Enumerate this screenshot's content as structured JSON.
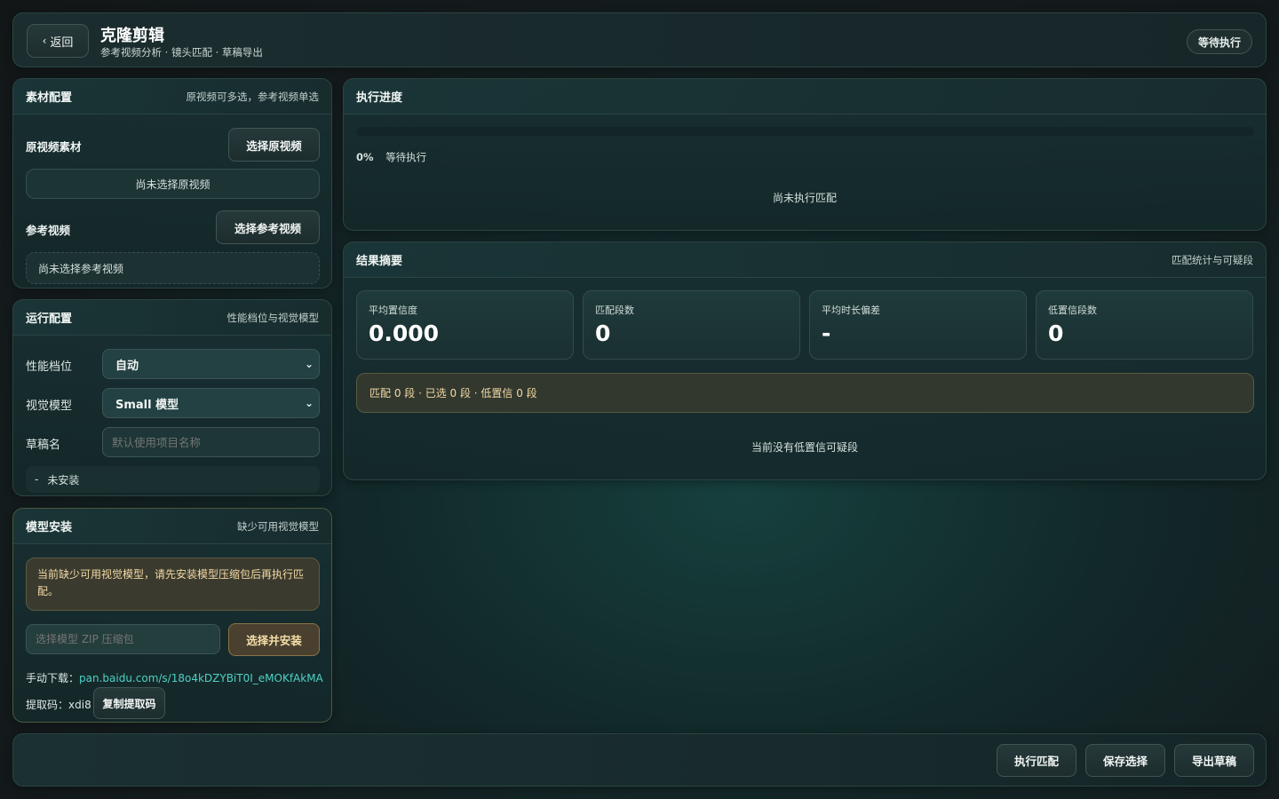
{
  "header": {
    "back_label": "返回",
    "title": "克隆剪辑",
    "subtitle": "参考视频分析 · 镜头匹配 · 草稿导出",
    "status_badge": "等待执行"
  },
  "materials": {
    "title": "素材配置",
    "subtitle": "原视频可多选，参考视频单选",
    "source_label": "原视频素材",
    "source_button": "选择原视频",
    "source_empty": "尚未选择原视频",
    "ref_label": "参考视频",
    "ref_button": "选择参考视频",
    "ref_empty": "尚未选择参考视频"
  },
  "run_config": {
    "title": "运行配置",
    "subtitle": "性能档位与视觉模型",
    "perf_label": "性能档位",
    "perf_value": "自动",
    "model_label": "视觉模型",
    "model_value": "Small 模型",
    "draft_label": "草稿名",
    "draft_placeholder": "默认使用项目名称",
    "install_status_dash": "-",
    "install_status": "未安装"
  },
  "model_install": {
    "title": "模型安装",
    "subtitle": "缺少可用视觉模型",
    "warning": "当前缺少可用视觉模型，请先安装模型压缩包后再执行匹配。",
    "zip_placeholder": "选择模型 ZIP 压缩包",
    "install_button": "选择并安装",
    "download_label": "手动下载：",
    "download_link": "pan.baidu.com/s/18o4kDZYBiT0I_eMOKfAkMA",
    "code_label": "提取码：",
    "code_value": "xdi8",
    "copy_button": "复制提取码"
  },
  "progress": {
    "title": "执行进度",
    "percent": "0%",
    "percent_value": 0,
    "status": "等待执行",
    "empty": "尚未执行匹配"
  },
  "summary": {
    "title": "结果摘要",
    "subtitle": "匹配统计与可疑段",
    "cards": [
      {
        "label": "平均置信度",
        "value": "0.000"
      },
      {
        "label": "匹配段数",
        "value": "0"
      },
      {
        "label": "平均时长偏差",
        "value": "-"
      },
      {
        "label": "低置信段数",
        "value": "0"
      }
    ],
    "notice": "匹配 0 段 · 已选 0 段 · 低置信 0 段",
    "empty": "当前没有低置信可疑段"
  },
  "footer": {
    "run_button": "执行匹配",
    "save_button": "保存选择",
    "export_button": "导出草稿"
  },
  "colors": {
    "accent_link": "#4fd1c5",
    "warning_text": "#f3d9a6",
    "warning_bg": "#3a3a2e",
    "install_button_bg": "#4a4030"
  }
}
